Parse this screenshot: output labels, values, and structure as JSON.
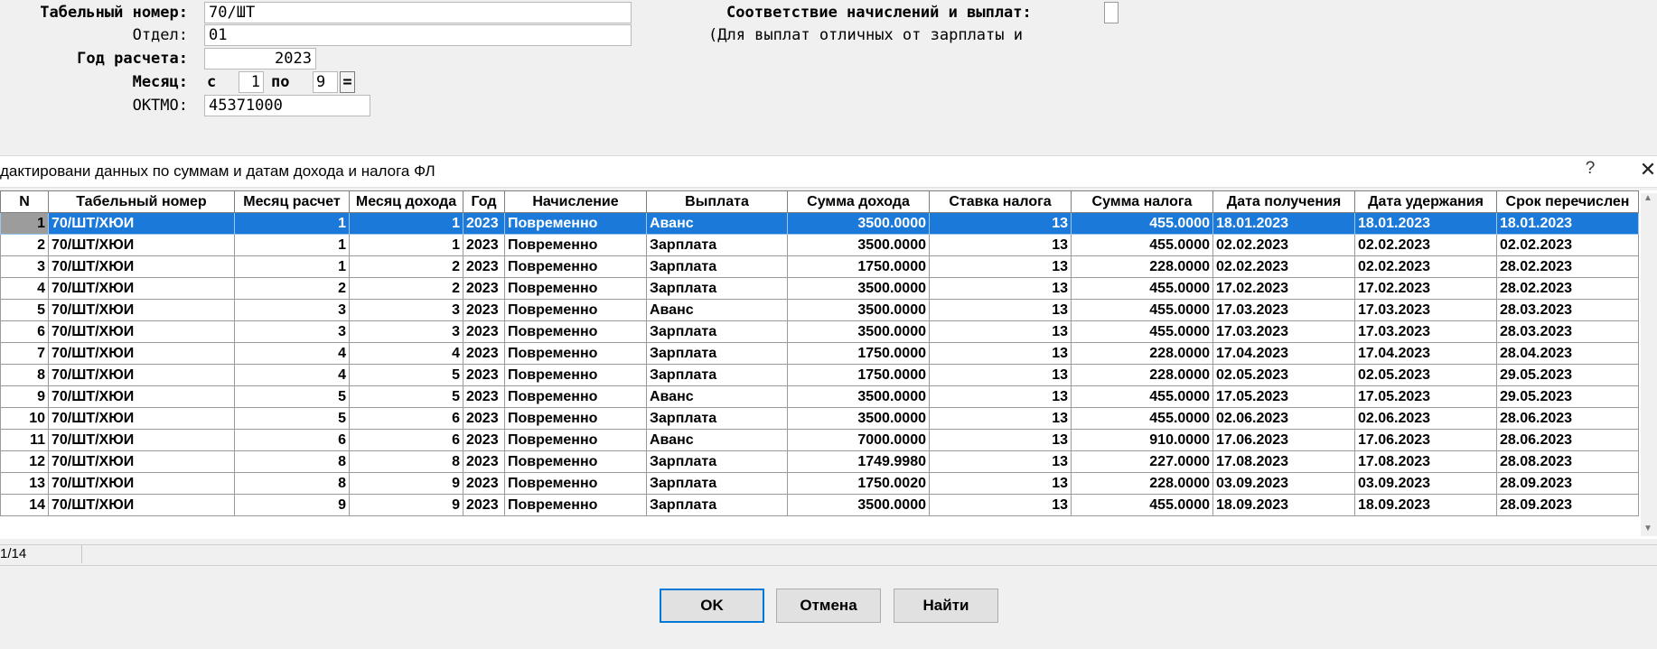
{
  "form": {
    "tab_label": "Табельный номер:",
    "tab_value": "70/ШТ",
    "dept_label": "Отдел:",
    "dept_value": "01",
    "year_label": "Год расчета:",
    "year_value": "2023",
    "month_label": "Месяц:",
    "month_from_label": "с",
    "month_from_value": "1",
    "month_to_label": "по",
    "month_to_value": "9",
    "eq_button": "=",
    "oktmo_label": "ОКТМО:",
    "oktmo_value": "45371000",
    "match_label": "Соответствие начислений и выплат:",
    "note": "(Для выплат отличных от зарплаты и"
  },
  "dialog": {
    "title": "дактировани данных по суммам и датам дохода и налога ФЛ",
    "help": "?",
    "close": "✕"
  },
  "table": {
    "columns": [
      "N",
      "Табельный номер",
      "Месяц расчет",
      "Месяц дохода",
      "Год",
      "Начисление",
      "Выплата",
      "Сумма дохода",
      "Ставка налога",
      "Сумма налога",
      "Дата получения",
      "Дата удержания",
      "Срок перечислен"
    ],
    "rows": [
      [
        "1",
        "70/ШТ/ХЮИ",
        "1",
        "1",
        "2023",
        "Повременно",
        "Аванс",
        "3500.0000",
        "13",
        "455.0000",
        "18.01.2023",
        "18.01.2023",
        "18.01.2023"
      ],
      [
        "2",
        "70/ШТ/ХЮИ",
        "1",
        "1",
        "2023",
        "Повременно",
        "Зарплата",
        "3500.0000",
        "13",
        "455.0000",
        "02.02.2023",
        "02.02.2023",
        "02.02.2023"
      ],
      [
        "3",
        "70/ШТ/ХЮИ",
        "1",
        "2",
        "2023",
        "Повременно",
        "Зарплата",
        "1750.0000",
        "13",
        "228.0000",
        "02.02.2023",
        "02.02.2023",
        "28.02.2023"
      ],
      [
        "4",
        "70/ШТ/ХЮИ",
        "2",
        "2",
        "2023",
        "Повременно",
        "Зарплата",
        "3500.0000",
        "13",
        "455.0000",
        "17.02.2023",
        "17.02.2023",
        "28.02.2023"
      ],
      [
        "5",
        "70/ШТ/ХЮИ",
        "3",
        "3",
        "2023",
        "Повременно",
        "Аванс",
        "3500.0000",
        "13",
        "455.0000",
        "17.03.2023",
        "17.03.2023",
        "28.03.2023"
      ],
      [
        "6",
        "70/ШТ/ХЮИ",
        "3",
        "3",
        "2023",
        "Повременно",
        "Зарплата",
        "3500.0000",
        "13",
        "455.0000",
        "17.03.2023",
        "17.03.2023",
        "28.03.2023"
      ],
      [
        "7",
        "70/ШТ/ХЮИ",
        "4",
        "4",
        "2023",
        "Повременно",
        "Зарплата",
        "1750.0000",
        "13",
        "228.0000",
        "17.04.2023",
        "17.04.2023",
        "28.04.2023"
      ],
      [
        "8",
        "70/ШТ/ХЮИ",
        "4",
        "5",
        "2023",
        "Повременно",
        "Зарплата",
        "1750.0000",
        "13",
        "228.0000",
        "02.05.2023",
        "02.05.2023",
        "29.05.2023"
      ],
      [
        "9",
        "70/ШТ/ХЮИ",
        "5",
        "5",
        "2023",
        "Повременно",
        "Аванс",
        "3500.0000",
        "13",
        "455.0000",
        "17.05.2023",
        "17.05.2023",
        "29.05.2023"
      ],
      [
        "10",
        "70/ШТ/ХЮИ",
        "5",
        "6",
        "2023",
        "Повременно",
        "Зарплата",
        "3500.0000",
        "13",
        "455.0000",
        "02.06.2023",
        "02.06.2023",
        "28.06.2023"
      ],
      [
        "11",
        "70/ШТ/ХЮИ",
        "6",
        "6",
        "2023",
        "Повременно",
        "Аванс",
        "7000.0000",
        "13",
        "910.0000",
        "17.06.2023",
        "17.06.2023",
        "28.06.2023"
      ],
      [
        "12",
        "70/ШТ/ХЮИ",
        "8",
        "8",
        "2023",
        "Повременно",
        "Зарплата",
        "1749.9980",
        "13",
        "227.0000",
        "17.08.2023",
        "17.08.2023",
        "28.08.2023"
      ],
      [
        "13",
        "70/ШТ/ХЮИ",
        "8",
        "9",
        "2023",
        "Повременно",
        "Зарплата",
        "1750.0020",
        "13",
        "228.0000",
        "03.09.2023",
        "03.09.2023",
        "28.09.2023"
      ],
      [
        "14",
        "70/ШТ/ХЮИ",
        "9",
        "9",
        "2023",
        "Повременно",
        "Зарплата",
        "3500.0000",
        "13",
        "455.0000",
        "18.09.2023",
        "18.09.2023",
        "28.09.2023"
      ]
    ],
    "selected_row": 0
  },
  "status": {
    "record": "1/14"
  },
  "buttons": {
    "ok": "OK",
    "cancel": "Отмена",
    "find": "Найти"
  },
  "colors": {
    "selection": "#1b7ad9",
    "ok_border": "#0078d7"
  }
}
